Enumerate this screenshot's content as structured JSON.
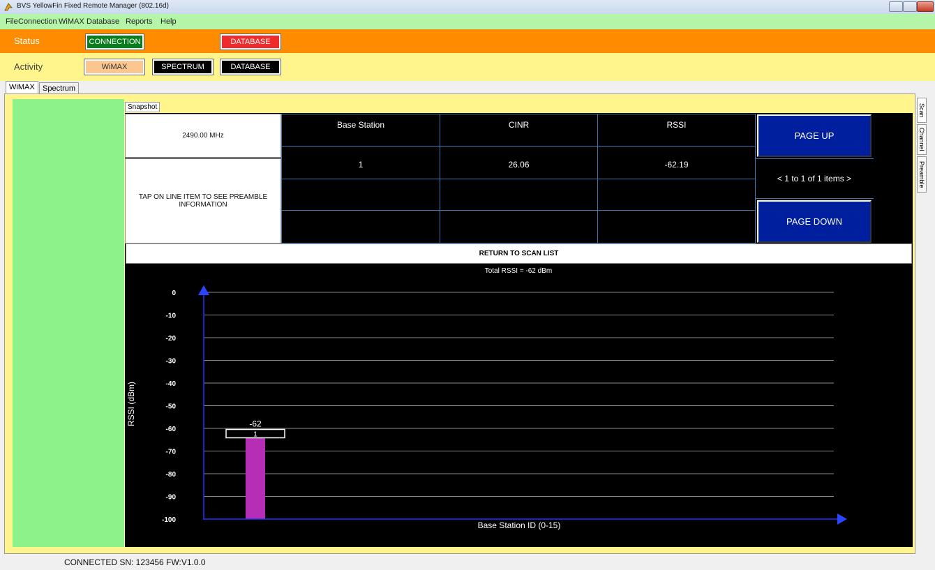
{
  "window": {
    "title": "BVS YellowFin Fixed Remote Manager (802.16d)"
  },
  "menu": [
    "File",
    "Connection",
    "WiMAX",
    "Database",
    "Reports",
    "Help"
  ],
  "status": {
    "label": "Status",
    "connection_label": "CONNECTION",
    "database_label": "DATABASE",
    "connection_color": "#0a7d1e",
    "database_color": "#f02b2b"
  },
  "activity": {
    "label": "Activity",
    "wimax_label": "WiMAX",
    "spectrum_label": "SPECTRUM",
    "database_label": "DATABASE"
  },
  "tabs": [
    "WiMAX",
    "Spectrum"
  ],
  "side_tabs": [
    "Scan",
    "Channel",
    "Preamble"
  ],
  "snapshot_label": "Snapshot",
  "frequency": "2490.00 MHz",
  "hint": "TAP ON LINE ITEM TO SEE PREAMBLE INFORMATION",
  "table": {
    "headers": [
      "Base Station",
      "CINR",
      "RSSI"
    ],
    "rows": [
      [
        "1",
        "26.06",
        "-62.19"
      ]
    ]
  },
  "pager": {
    "page_up": "PAGE UP",
    "page_down": "PAGE DOWN",
    "info": "< 1 to 1 of 1 items >"
  },
  "return_label": "RETURN TO SCAN LIST",
  "chart_data": {
    "type": "bar",
    "title": "Total RSSI = -62 dBm",
    "xlabel": "Base Station ID (0-15)",
    "ylabel": "RSSI (dBm)",
    "ylim": [
      -100,
      0
    ],
    "yticks": [
      0,
      -10,
      -20,
      -30,
      -40,
      -50,
      -60,
      -70,
      -80,
      -90,
      -100
    ],
    "categories": [
      "1"
    ],
    "values": [
      -62
    ],
    "data_labels": [
      "-62"
    ],
    "bar_color": "#b52eb5",
    "grid": true
  },
  "footer": {
    "status": "CONNECTED SN: 123456   FW:V1.0.0"
  }
}
